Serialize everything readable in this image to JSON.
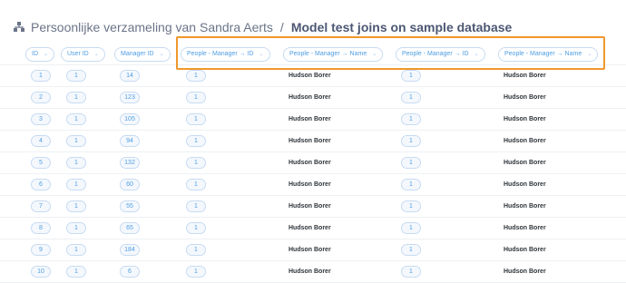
{
  "header": {
    "collection": "Persoonlijke verzameling van Sandra Aerts",
    "separator": "/",
    "title": "Model test joins on sample database"
  },
  "columns": [
    "ID",
    "User ID",
    "Manager ID",
    "People - Manager → ID",
    "People - Manager → Name",
    "People - Manager → ID",
    "People - Manager → Name"
  ],
  "rows": [
    {
      "id": "1",
      "user_id": "1",
      "manager_id": "14",
      "pm_id": "1",
      "pm_name": "Hudson Borer",
      "pm_id2": "1",
      "pm_name2": "Hudson Borer"
    },
    {
      "id": "2",
      "user_id": "1",
      "manager_id": "123",
      "pm_id": "1",
      "pm_name": "Hudson Borer",
      "pm_id2": "1",
      "pm_name2": "Hudson Borer"
    },
    {
      "id": "3",
      "user_id": "1",
      "manager_id": "105",
      "pm_id": "1",
      "pm_name": "Hudson Borer",
      "pm_id2": "1",
      "pm_name2": "Hudson Borer"
    },
    {
      "id": "4",
      "user_id": "1",
      "manager_id": "94",
      "pm_id": "1",
      "pm_name": "Hudson Borer",
      "pm_id2": "1",
      "pm_name2": "Hudson Borer"
    },
    {
      "id": "5",
      "user_id": "1",
      "manager_id": "132",
      "pm_id": "1",
      "pm_name": "Hudson Borer",
      "pm_id2": "1",
      "pm_name2": "Hudson Borer"
    },
    {
      "id": "6",
      "user_id": "1",
      "manager_id": "60",
      "pm_id": "1",
      "pm_name": "Hudson Borer",
      "pm_id2": "1",
      "pm_name2": "Hudson Borer"
    },
    {
      "id": "7",
      "user_id": "1",
      "manager_id": "55",
      "pm_id": "1",
      "pm_name": "Hudson Borer",
      "pm_id2": "1",
      "pm_name2": "Hudson Borer"
    },
    {
      "id": "8",
      "user_id": "1",
      "manager_id": "65",
      "pm_id": "1",
      "pm_name": "Hudson Borer",
      "pm_id2": "1",
      "pm_name2": "Hudson Borer"
    },
    {
      "id": "9",
      "user_id": "1",
      "manager_id": "184",
      "pm_id": "1",
      "pm_name": "Hudson Borer",
      "pm_id2": "1",
      "pm_name2": "Hudson Borer"
    },
    {
      "id": "10",
      "user_id": "1",
      "manager_id": "6",
      "pm_id": "1",
      "pm_name": "Hudson Borer",
      "pm_id2": "1",
      "pm_name2": "Hudson Borer"
    }
  ],
  "icons": {
    "collection": "collection-icon",
    "sort": "chevron-down-icon"
  },
  "colors": {
    "accent": "#509ee3",
    "highlight": "#f0982d",
    "text": "#4c5773"
  }
}
